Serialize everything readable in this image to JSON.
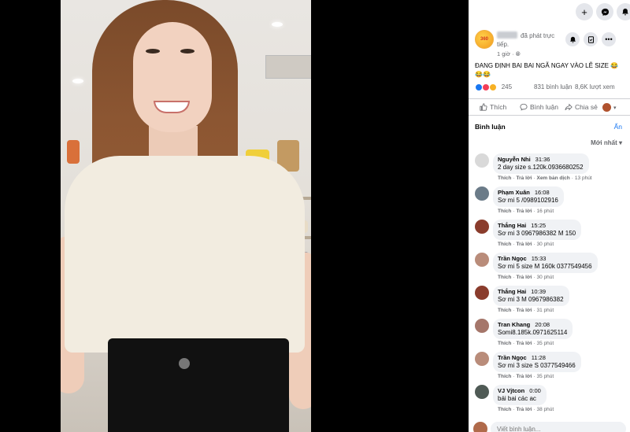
{
  "post": {
    "live_text": "đã phát trực tiếp.",
    "time": "1 giờ · ",
    "caption": "ĐANG ĐỊNH BAI BAI NGÃ NGAY VÀO LỄ SIZE 😂😂😂",
    "reactions_count": "245",
    "comments_count": "831 bình luận",
    "views": "8,6K lượt xem",
    "like_label": "Thích",
    "comment_label": "Bình luận",
    "share_label": "Chia sẻ"
  },
  "comments_section": {
    "title": "Bình luận",
    "hide_label": "Ẩn",
    "sort_label": "Mới nhất"
  },
  "comments": [
    {
      "name": "Nguyễn Nhi",
      "time": "31:36",
      "text": "2 day size s.120k.0936680252",
      "like": "Thích",
      "reply": "Trả lời",
      "extra": "Xem bản dịch",
      "ago": "13 phút",
      "color": "#d9d9d9"
    },
    {
      "name": "Phạm Xuân",
      "time": "16:08",
      "text": "Sơ mi 5 /0989102916",
      "like": "Thích",
      "reply": "Trả lời",
      "ago": "16 phút",
      "color": "#6b7b88"
    },
    {
      "name": "Thắng Hai",
      "time": "15:25",
      "text": "Sơ mi 3 0967986382 M 150",
      "like": "Thích",
      "reply": "Trả lời",
      "ago": "30 phút",
      "color": "#8a3c2c"
    },
    {
      "name": "Trần Ngọc",
      "time": "15:33",
      "text": "Sơ mi 5 size M 160k 0377549456",
      "like": "Thích",
      "reply": "Trả lời",
      "ago": "30 phút",
      "color": "#b98c7a"
    },
    {
      "name": "Thắng Hai",
      "time": "10:39",
      "text": "Sơ mi 3 M 0967986382",
      "like": "Thích",
      "reply": "Trả lời",
      "ago": "31 phút",
      "color": "#8a3c2c"
    },
    {
      "name": "Tran Khang",
      "time": "20:08",
      "text": "Somi8.185k.0971625114",
      "like": "Thích",
      "reply": "Trả lời",
      "ago": "35 phút",
      "color": "#a5766a"
    },
    {
      "name": "Trần Ngọc",
      "time": "11:28",
      "text": "Sơ mi 3 size S 0377549466",
      "like": "Thích",
      "reply": "Trả lời",
      "ago": "35 phút",
      "color": "#b98c7a"
    },
    {
      "name": "VJ Vjtcon",
      "time": "0:00",
      "text": "bái bai các ac",
      "like": "Thích",
      "reply": "Trả lời",
      "ago": "38 phút",
      "color": "#4f5a55"
    }
  ],
  "composer": {
    "placeholder": "Viết bình luận..."
  },
  "colors": {
    "accent": "#1877f2",
    "like_blue": "#1877f2",
    "love_red": "#f33e58",
    "haha_yellow": "#f7b125"
  }
}
